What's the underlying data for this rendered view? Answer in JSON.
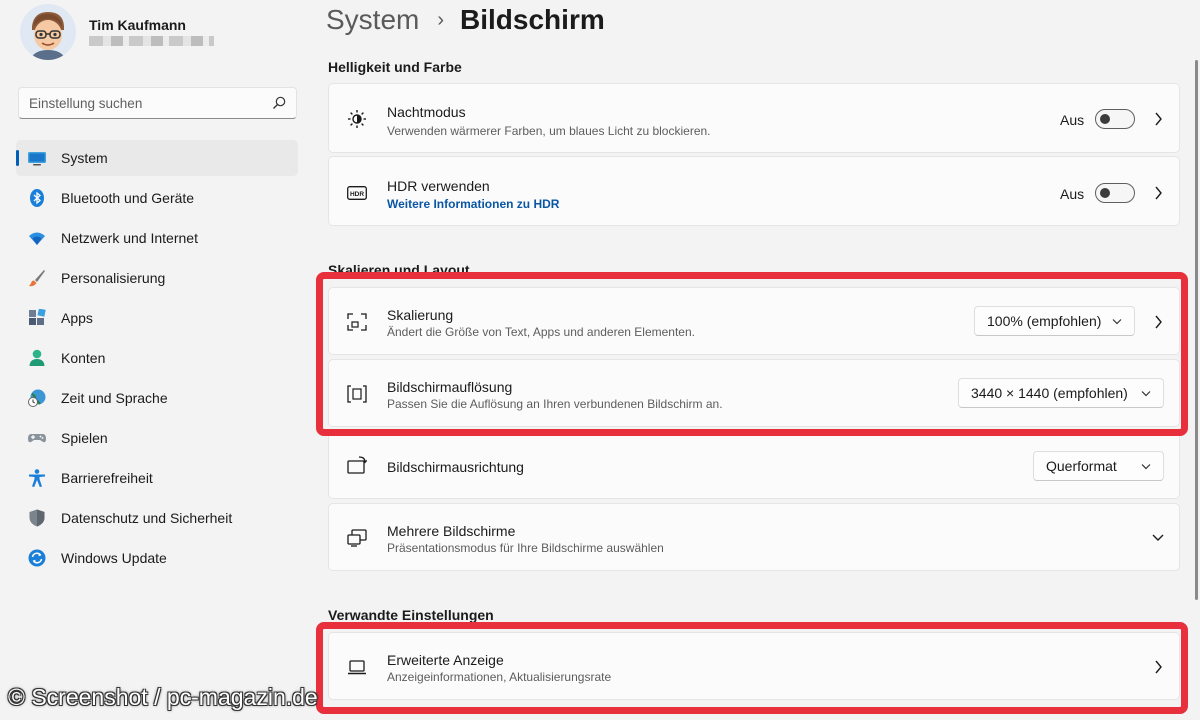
{
  "user": {
    "name": "Tim Kaufmann"
  },
  "search": {
    "placeholder": "Einstellung suchen"
  },
  "nav": [
    {
      "label": "System",
      "icon": "monitor-icon",
      "active": true
    },
    {
      "label": "Bluetooth und Geräte",
      "icon": "bluetooth-icon"
    },
    {
      "label": "Netzwerk und Internet",
      "icon": "wifi-icon"
    },
    {
      "label": "Personalisierung",
      "icon": "brush-icon"
    },
    {
      "label": "Apps",
      "icon": "apps-icon"
    },
    {
      "label": "Konten",
      "icon": "person-icon"
    },
    {
      "label": "Zeit und Sprache",
      "icon": "clock-globe-icon"
    },
    {
      "label": "Spielen",
      "icon": "gamepad-icon"
    },
    {
      "label": "Barrierefreiheit",
      "icon": "accessibility-icon"
    },
    {
      "label": "Datenschutz und Sicherheit",
      "icon": "shield-icon"
    },
    {
      "label": "Windows Update",
      "icon": "update-icon"
    }
  ],
  "breadcrumb": {
    "parent": "System",
    "separator": "›",
    "current": "Bildschirm"
  },
  "sections": {
    "brightness": "Helligkeit und Farbe",
    "scaling": "Skalieren und Layout",
    "related": "Verwandte Einstellungen"
  },
  "cards": {
    "night": {
      "title": "Nachtmodus",
      "sub": "Verwenden wärmerer Farben, um blaues Licht zu blockieren.",
      "toggle_label": "Aus",
      "on": false
    },
    "hdr": {
      "title": "HDR verwenden",
      "link": "Weitere Informationen zu HDR",
      "toggle_label": "Aus",
      "on": false
    },
    "scale": {
      "title": "Skalierung",
      "sub": "Ändert die Größe von Text, Apps und anderen Elementen.",
      "value": "100% (empfohlen)"
    },
    "resolution": {
      "title": "Bildschirmauflösung",
      "sub": "Passen Sie die Auflösung an Ihren verbundenen Bildschirm an.",
      "value": "3440 × 1440 (empfohlen)"
    },
    "orientation": {
      "title": "Bildschirmausrichtung",
      "value": "Querformat"
    },
    "multi": {
      "title": "Mehrere Bildschirme",
      "sub": "Präsentationsmodus für Ihre Bildschirme auswählen"
    },
    "advanced": {
      "title": "Erweiterte Anzeige",
      "sub": "Anzeigeinformationen, Aktualisierungsrate"
    }
  },
  "watermark": "© Screenshot / pc-magazin.de",
  "colors": {
    "accent": "#005fb8",
    "highlight": "#e8303d",
    "link": "#0a56a5"
  }
}
